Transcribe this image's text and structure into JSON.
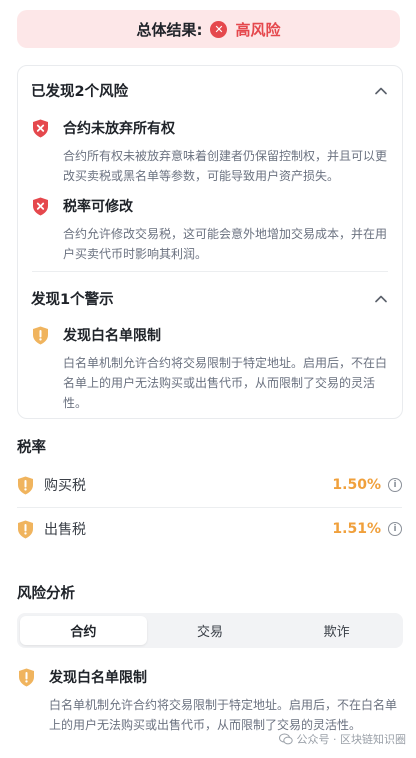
{
  "overall": {
    "label": "总体结果:",
    "value": "高风险",
    "icon": "x-circle-icon",
    "color": "#e5484d"
  },
  "risks": {
    "heading": "已发现2个风险",
    "items": [
      {
        "title": "合约未放弃所有权",
        "desc": "合约所有权未被放弃意味着创建者仍保留控制权，并且可以更改买卖税或黑名单等参数，可能导致用户资产损失。",
        "icon": "red-shield-x-icon"
      },
      {
        "title": "税率可修改",
        "desc": "合约允许修改交易税，这可能会意外地增加交易成本，并在用户买卖代币时影响其利润。",
        "icon": "red-shield-x-icon"
      }
    ]
  },
  "warnings": {
    "heading": "发现1个警示",
    "items": [
      {
        "title": "发现白名单限制",
        "desc": "白名单机制允许合约将交易限制于特定地址。启用后，不在白名单上的用户无法购买或出售代币，从而限制了交易的灵活性。",
        "icon": "orange-shield-exclamation-icon"
      }
    ]
  },
  "tax": {
    "heading": "税率",
    "rows": [
      {
        "name": "购买税",
        "value": "1.50%"
      },
      {
        "name": "出售税",
        "value": "1.51%"
      }
    ]
  },
  "analysis": {
    "heading": "风险分析",
    "tabs": [
      "合约",
      "交易",
      "欺诈"
    ],
    "active_tab": "合约",
    "item": {
      "title": "发现白名单限制",
      "desc": "白名单机制允许合约将交易限制于特定地址。启用后，不在白名单上的用户无法购买或出售代币，从而限制了交易的灵活性。"
    }
  },
  "watermark": "公众号 · 区块链知识圈",
  "colors": {
    "danger": "#e5484d",
    "warning": "#f0a03c"
  }
}
